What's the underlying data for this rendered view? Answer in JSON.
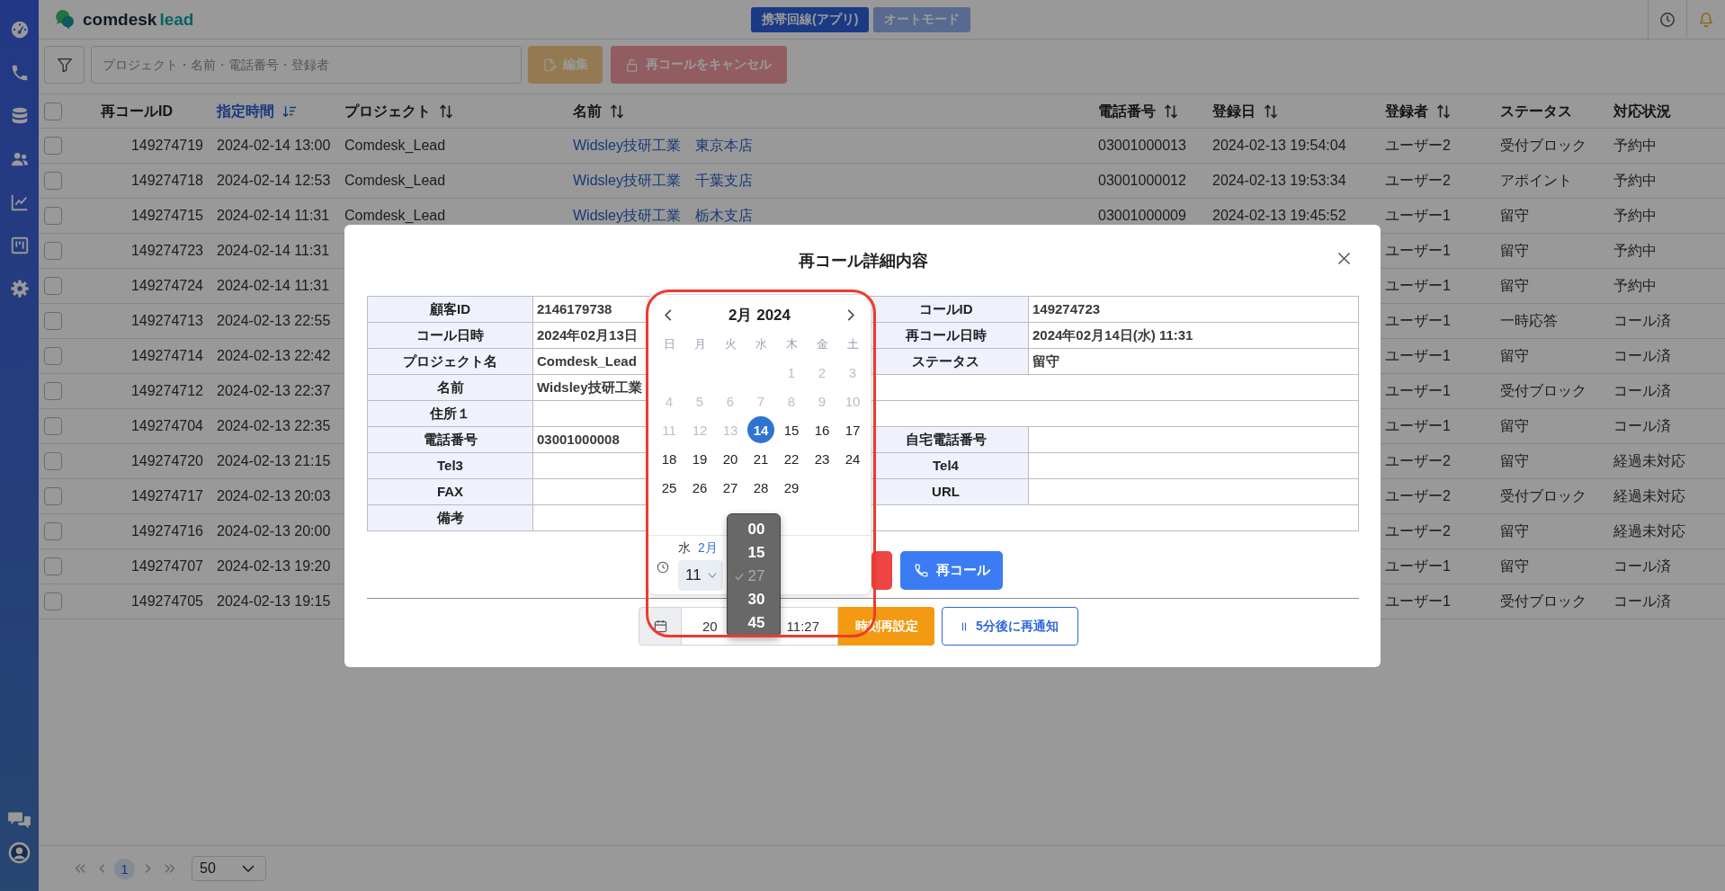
{
  "topbar": {
    "logo": {
      "name": "comdesk",
      "product": "lead"
    },
    "mode_buttons": [
      {
        "label": "携帯回線(アプリ)",
        "selected": true
      },
      {
        "label": "オートモード",
        "selected": false
      }
    ]
  },
  "toolbar": {
    "search": {
      "placeholder": "プロジェクト・名前・電話番号・登録者"
    },
    "buttons": [
      {
        "kind": "edit",
        "label": "編集",
        "disabled": true
      },
      {
        "kind": "cancel",
        "label": "再コールをキャンセル",
        "disabled": true
      }
    ]
  },
  "table": {
    "all_checked": false,
    "columns": [
      {
        "label": "再コールID",
        "sortable": false,
        "sorted": false
      },
      {
        "label": "指定時間",
        "sortable": true,
        "sorted": true
      },
      {
        "label": "プロジェクト",
        "sortable": true,
        "sorted": false
      },
      {
        "label": "名前",
        "sortable": true,
        "sorted": false
      },
      {
        "label": "電話番号",
        "sortable": true,
        "sorted": false
      },
      {
        "label": "登録日",
        "sortable": true,
        "sorted": false
      },
      {
        "label": "登録者",
        "sortable": true,
        "sorted": false
      },
      {
        "label": "ステータス",
        "sortable": false,
        "sorted": false
      },
      {
        "label": "対応状況",
        "sortable": false,
        "sorted": false
      }
    ],
    "rows": [
      {
        "checked": false,
        "id": "149274719",
        "scheduled_time": "2024-02-14 13:00",
        "project": "Comdesk_Lead",
        "name": "Widsley技研工業　東京本店",
        "phone": "03001000013",
        "registered": "2024-02-13 19:54:04",
        "registrant": "ユーザー2",
        "status": "受付ブロック",
        "progress": "予約中"
      },
      {
        "checked": false,
        "id": "149274718",
        "scheduled_time": "2024-02-14 12:53",
        "project": "Comdesk_Lead",
        "name": "Widsley技研工業　千葉支店",
        "phone": "03001000012",
        "registered": "2024-02-13 19:53:34",
        "registrant": "ユーザー2",
        "status": "アポイント",
        "progress": "予約中"
      },
      {
        "checked": false,
        "id": "149274715",
        "scheduled_time": "2024-02-14 11:31",
        "project": "Comdesk_Lead",
        "name": "Widsley技研工業　栃木支店",
        "phone": "03001000009",
        "registered": "2024-02-13 19:45:52",
        "registrant": "ユーザー1",
        "status": "留守",
        "progress": "予約中"
      },
      {
        "checked": false,
        "id": "149274723",
        "scheduled_time": "2024-02-14 11:31",
        "registrant": "ユーザー1",
        "status": "留守",
        "progress": "予約中"
      },
      {
        "checked": false,
        "id": "149274724",
        "scheduled_time": "2024-02-14 11:31",
        "registrant": "ユーザー1",
        "status": "留守",
        "progress": "予約中"
      },
      {
        "checked": false,
        "id": "149274713",
        "scheduled_time": "2024-02-13 22:55",
        "registrant": "ユーザー1",
        "status": "一時応答",
        "progress": "コール済"
      },
      {
        "checked": false,
        "id": "149274714",
        "scheduled_time": "2024-02-13 22:42",
        "registrant": "ユーザー1",
        "status": "留守",
        "progress": "コール済"
      },
      {
        "checked": false,
        "id": "149274712",
        "scheduled_time": "2024-02-13 22:37",
        "registrant": "ユーザー1",
        "status": "受付ブロック",
        "progress": "コール済"
      },
      {
        "checked": false,
        "id": "149274704",
        "scheduled_time": "2024-02-13 22:35",
        "registrant": "ユーザー1",
        "status": "留守",
        "progress": "コール済"
      },
      {
        "checked": false,
        "id": "149274720",
        "scheduled_time": "2024-02-13 21:15",
        "registrant": "ユーザー2",
        "status": "留守",
        "progress": "経過未対応"
      },
      {
        "checked": false,
        "id": "149274717",
        "scheduled_time": "2024-02-13 20:03",
        "registrant": "ユーザー2",
        "status": "受付ブロック",
        "progress": "経過未対応"
      },
      {
        "checked": false,
        "id": "149274716",
        "scheduled_time": "2024-02-13 20:00",
        "registrant": "ユーザー2",
        "status": "留守",
        "progress": "経過未対応"
      },
      {
        "checked": false,
        "id": "149274707",
        "scheduled_time": "2024-02-13 19:20",
        "registrant": "ユーザー1",
        "status": "留守",
        "progress": "コール済"
      },
      {
        "checked": false,
        "id": "149274705",
        "scheduled_time": "2024-02-13 19:15",
        "registrant": "ユーザー1",
        "status": "受付ブロック",
        "progress": "コール済"
      }
    ]
  },
  "pagination": {
    "pages": [
      {
        "label": "1",
        "selected": true
      }
    ],
    "page_size": "50"
  },
  "modal": {
    "title": "再コール詳細内容",
    "details": [
      {
        "cells": [
          {
            "label": "顧客ID",
            "value": "2146179738"
          },
          {
            "label": "コールID",
            "value": "149274723"
          }
        ]
      },
      {
        "cells": [
          {
            "label": "コール日時",
            "value": "2024年02月13日"
          },
          {
            "label": "再コール日時",
            "value": "2024年02月14日(水) 11:31"
          }
        ]
      },
      {
        "cells": [
          {
            "label": "プロジェクト名",
            "value": "Comdesk_Lead"
          },
          {
            "label": "ステータス",
            "value": "留守"
          }
        ]
      },
      {
        "cells": [
          {
            "label": "名前",
            "value": "Widsley技研工業"
          }
        ]
      },
      {
        "cells": [
          {
            "label": "住所１"
          }
        ]
      },
      {
        "cells": [
          {
            "label": "電話番号",
            "value": "03001000008"
          },
          {
            "label": "自宅電話番号"
          }
        ]
      },
      {
        "cells": [
          {
            "label": "Tel3"
          },
          {
            "label": "Tel4"
          }
        ]
      },
      {
        "cells": [
          {
            "label": "FAX"
          },
          {
            "label": "URL"
          }
        ]
      },
      {
        "cells": [
          {
            "label": "備考"
          }
        ]
      }
    ],
    "action_buttons": [
      {
        "kind": "danger"
      },
      {
        "kind": "primary",
        "label": "再コール"
      }
    ],
    "datetime_input": {
      "value_visible": [
        "20",
        "11:27"
      ]
    },
    "reset_button": {
      "label": "時刻再設定"
    },
    "snooze_button": {
      "label": "5分後に再通知"
    }
  },
  "date_picker": {
    "month_label": "2月 2024",
    "weekdays": [
      "日",
      "月",
      "火",
      "水",
      "木",
      "金",
      "土"
    ],
    "weeks": [
      [
        {
          "label": "1",
          "disabled": true,
          "selected": false
        },
        {
          "label": "2",
          "disabled": true,
          "selected": false
        },
        {
          "label": "3",
          "disabled": true,
          "selected": false
        }
      ],
      [
        {
          "label": "4",
          "disabled": true,
          "selected": false
        },
        {
          "label": "5",
          "disabled": true,
          "selected": false
        },
        {
          "label": "6",
          "disabled": true,
          "selected": false
        },
        {
          "label": "7",
          "disabled": true,
          "selected": false
        },
        {
          "label": "8",
          "disabled": true,
          "selected": false
        },
        {
          "label": "9",
          "disabled": true,
          "selected": false
        },
        {
          "label": "10",
          "disabled": true,
          "selected": false
        }
      ],
      [
        {
          "label": "11",
          "disabled": true,
          "selected": false
        },
        {
          "label": "12",
          "disabled": true,
          "selected": false
        },
        {
          "label": "13",
          "disabled": true,
          "selected": false
        },
        {
          "label": "14",
          "disabled": false,
          "selected": true
        },
        {
          "label": "15",
          "disabled": false,
          "selected": false
        },
        {
          "label": "16",
          "disabled": false,
          "selected": false
        },
        {
          "label": "17",
          "disabled": false,
          "selected": false
        }
      ],
      [
        {
          "label": "18",
          "disabled": false,
          "selected": false
        },
        {
          "label": "19",
          "disabled": false,
          "selected": false
        },
        {
          "label": "20",
          "disabled": false,
          "selected": false
        },
        {
          "label": "21",
          "disabled": false,
          "selected": false
        },
        {
          "label": "22",
          "disabled": false,
          "selected": false
        },
        {
          "label": "23",
          "disabled": false,
          "selected": false
        },
        {
          "label": "24",
          "disabled": false,
          "selected": false
        }
      ],
      [
        {
          "label": "25",
          "disabled": false,
          "selected": false
        },
        {
          "label": "26",
          "disabled": false,
          "selected": false
        },
        {
          "label": "27",
          "disabled": false,
          "selected": false
        },
        {
          "label": "28",
          "disabled": false,
          "selected": false
        },
        {
          "label": "29",
          "disabled": false,
          "selected": false
        }
      ]
    ],
    "time": {
      "weekday": "水",
      "month": "2月",
      "hour": "11"
    },
    "minute_options": [
      {
        "label": "00",
        "selected": false
      },
      {
        "label": "15",
        "selected": false
      },
      {
        "label": "27",
        "selected": true
      },
      {
        "label": "30",
        "selected": false
      },
      {
        "label": "45",
        "selected": false
      }
    ]
  }
}
